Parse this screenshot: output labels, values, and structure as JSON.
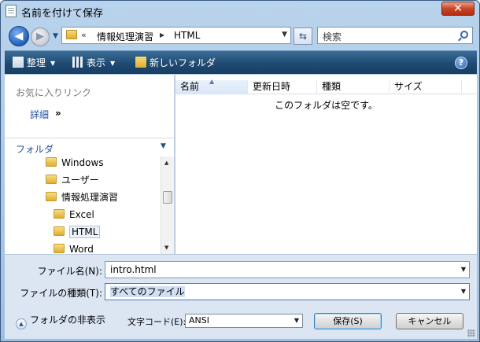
{
  "window": {
    "title": "名前を付けて保存",
    "close_label": "✕"
  },
  "nav": {
    "back_glyph": "◀",
    "forward_glyph": "▶",
    "breadcrumb_overflow": "«",
    "path": [
      "情報処理演習",
      "HTML"
    ],
    "search_placeholder": "検索"
  },
  "toolbar": {
    "organize": "整理",
    "views": "表示",
    "new_folder": "新しいフォルダ",
    "help": "?"
  },
  "left_panel": {
    "favorites_header": "お気に入りリンク",
    "detail_link": "詳細",
    "more_glyph": "»",
    "folders_header": "フォルダ",
    "tree": [
      {
        "label": "Windows",
        "indent": 1,
        "selected": false
      },
      {
        "label": "ユーザー",
        "indent": 1,
        "selected": false
      },
      {
        "label": "情報処理演習",
        "indent": 1,
        "selected": false
      },
      {
        "label": "Excel",
        "indent": 2,
        "selected": false
      },
      {
        "label": "HTML",
        "indent": 2,
        "selected": true
      },
      {
        "label": "Word",
        "indent": 2,
        "selected": false
      }
    ]
  },
  "file_list": {
    "columns": [
      "名前",
      "更新日時",
      "種類",
      "サイズ"
    ],
    "sorted_column": "名前",
    "empty_message": "このフォルダは空です。"
  },
  "form": {
    "filename_label": "ファイル名(N):",
    "filename_value": "intro.html",
    "filetype_label": "ファイルの種類(T):",
    "filetype_value": "すべてのファイル",
    "hide_folders_label": "フォルダの非表示",
    "encoding_label": "文字コード(E):",
    "encoding_value": "ANSI",
    "save_label": "保存(S)",
    "cancel_label": "キャンセル"
  }
}
